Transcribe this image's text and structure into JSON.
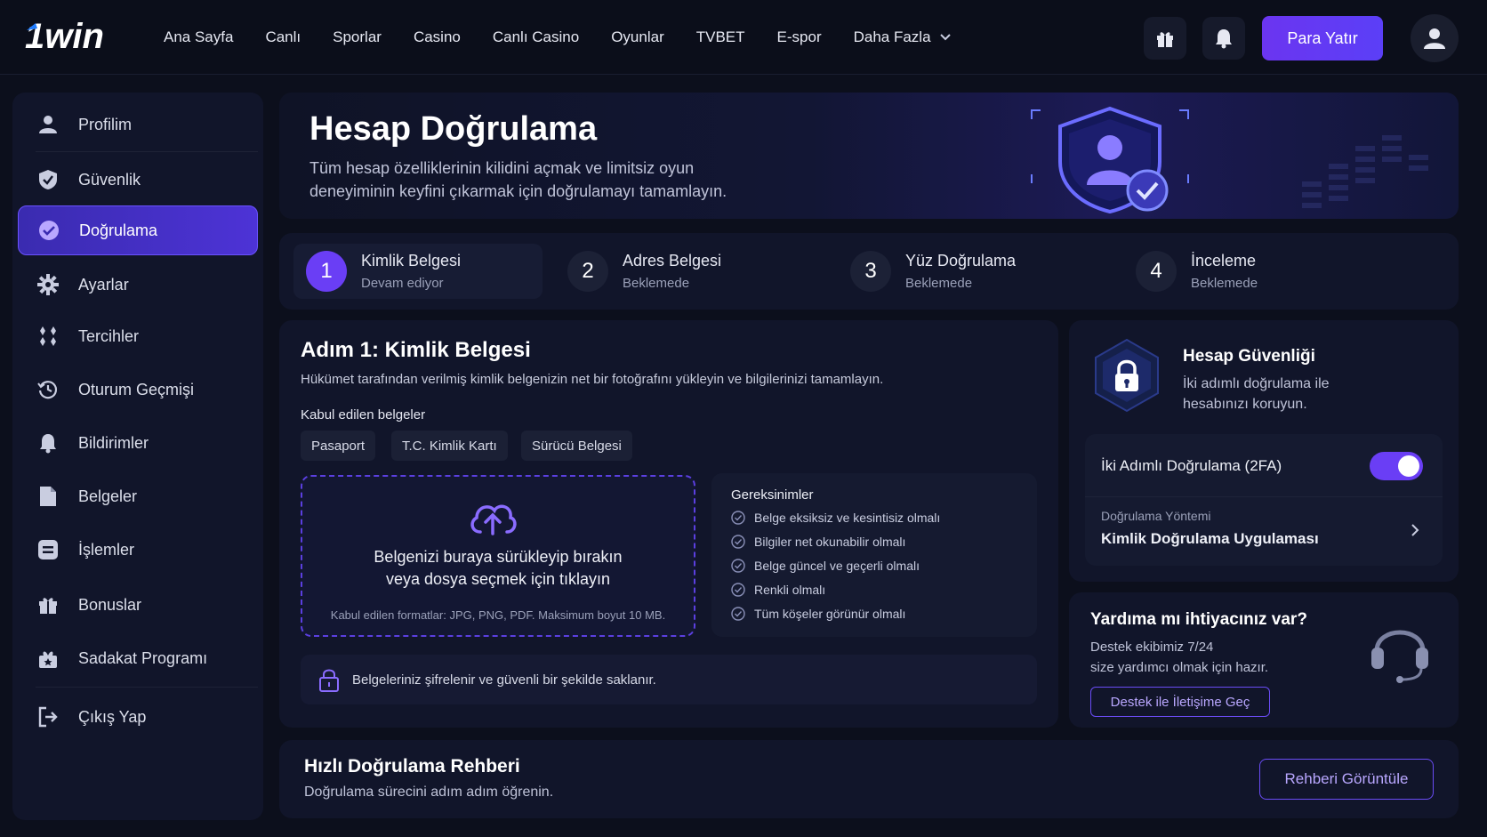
{
  "brand": {
    "logo_text": "1win",
    "accent": "#6a3ef5"
  },
  "nav": {
    "items": [
      "Ana Sayfa",
      "Canlı",
      "Sporlar",
      "Casino",
      "Canlı Casino",
      "Oyunlar",
      "TVBET",
      "E-spor",
      "Daha Fazla"
    ],
    "deposit_label": "Para Yatır"
  },
  "sidebar": {
    "items": [
      {
        "label": "Profilim",
        "icon": "user-icon"
      },
      {
        "label": "Güvenlik",
        "icon": "shield-icon"
      },
      {
        "label": "Doğrulama",
        "icon": "check-circle-icon",
        "active": true
      },
      {
        "label": "Ayarlar",
        "icon": "gear-icon"
      },
      {
        "label": "Tercihler",
        "icon": "preferences-icon"
      },
      {
        "label": "Oturum Geçmişi",
        "icon": "history-icon"
      },
      {
        "label": "Bildirimler",
        "icon": "bell-icon"
      },
      {
        "label": "Belgeler",
        "icon": "document-icon"
      },
      {
        "label": "İşlemler",
        "icon": "transactions-icon"
      },
      {
        "label": "Bonuslar",
        "icon": "gift-icon"
      },
      {
        "label": "Sadakat Programı",
        "icon": "loyalty-icon"
      },
      {
        "label": "Çıkış Yap",
        "icon": "logout-icon"
      }
    ]
  },
  "hero": {
    "title": "Hesap Doğrulama",
    "subtitle": "Tüm hesap özelliklerinin kilidini açmak ve limitsiz oyun deneyiminin keyfini çıkarmak için doğrulamayı tamamlayın."
  },
  "steps": [
    {
      "num": "1",
      "title": "Kimlik Belgesi",
      "status": "Devam ediyor"
    },
    {
      "num": "2",
      "title": "Adres Belgesi",
      "status": "Beklemede"
    },
    {
      "num": "3",
      "title": "Yüz Doğrulama",
      "status": "Beklemede"
    },
    {
      "num": "4",
      "title": "İnceleme",
      "status": "Beklemede"
    }
  ],
  "main": {
    "title": "Adım 1: Kimlik Belgesi",
    "subtitle": "Hükümet tarafından verilmiş kimlik belgenizin net bir fotoğrafını yükleyin ve bilgilerinizi tamamlayın.",
    "accepted_label": "Kabul edilen belgeler",
    "accepted_docs": [
      "Pasaport",
      "T.C. Kimlik Kartı",
      "Sürücü Belgesi"
    ],
    "upload_line1": "Belgenizi buraya sürükleyip bırakın",
    "upload_line2": "veya dosya seçmek için tıklayın",
    "upload_formats": "Kabul edilen formatlar: JPG, PNG, PDF. Maksimum boyut 10 MB.",
    "requirements_title": "Gereksinimler",
    "requirements": [
      "Belge eksiksiz ve kesintisiz olmalı",
      "Bilgiler net okunabilir olmalı",
      "Belge güncel ve geçerli olmalı",
      "Renkli olmalı",
      "Tüm köşeler görünür olmalı"
    ],
    "secure_note": "Belgeleriniz şifrelenir ve güvenli bir şekilde saklanır."
  },
  "security": {
    "title": "Hesap Güvenliği",
    "subtitle": "İki adımlı doğrulama ile hesabınızı koruyun.",
    "twofa_label": "İki Adımlı Doğrulama (2FA)",
    "twofa_enabled": true,
    "method_label": "Doğrulama Yöntemi",
    "method_value": "Kimlik Doğrulama Uygulaması"
  },
  "help": {
    "title": "Yardıma mı ihtiyacınız var?",
    "line1": "Destek ekibimiz 7/24",
    "line2": "size yardımcı olmak için hazır.",
    "button": "Destek ile İletişime Geç"
  },
  "guide": {
    "title": "Hızlı Doğrulama Rehberi",
    "subtitle": "Doğrulama sürecini adım adım öğrenin.",
    "button": "Rehberi Görüntüle"
  }
}
